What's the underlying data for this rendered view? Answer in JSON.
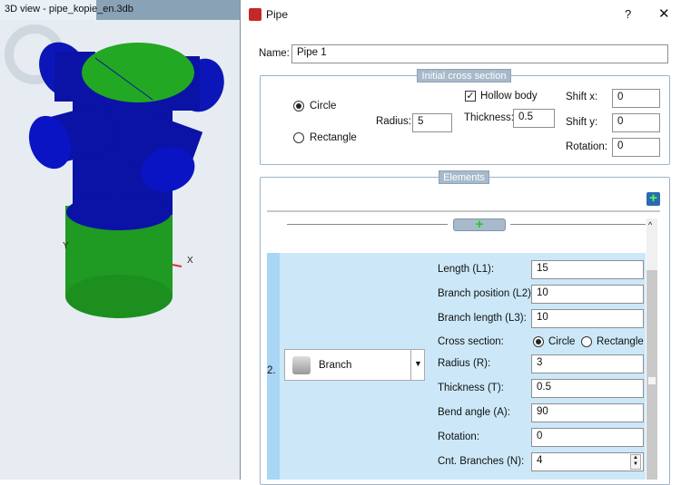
{
  "view": {
    "tab_title": "3D view - pipe_kopie_en.3db",
    "axis_x": "X",
    "axis_y": "Y"
  },
  "dialog": {
    "title": "Pipe",
    "help": "?",
    "close": "✕",
    "name_label": "Name:",
    "name_value": "Pipe 1",
    "initial": {
      "legend": "Initial cross section",
      "circle": "Circle",
      "rectangle": "Rectangle",
      "radius_label": "Radius:",
      "radius": "5",
      "hollow": "Hollow body",
      "thickness_label": "Thickness:",
      "thickness": "0.5",
      "shiftx_label": "Shift x:",
      "shiftx": "0",
      "shifty_label": "Shift y:",
      "shifty": "0",
      "rotation_label": "Rotation:",
      "rotation": "0"
    },
    "elements": {
      "legend": "Elements",
      "index": "2.",
      "type": "Branch",
      "fields": [
        {
          "label": "Length (L1):",
          "value": "15"
        },
        {
          "label": "Branch position (L2):",
          "value": "10"
        },
        {
          "label": "Branch length (L3):",
          "value": "10"
        }
      ],
      "cross_label": "Cross section:",
      "cross_circle": "Circle",
      "cross_rect": "Rectangle",
      "fields2": [
        {
          "label": "Radius (R):",
          "value": "3"
        },
        {
          "label": "Thickness (T):",
          "value": "0.5"
        },
        {
          "label": "Bend angle (A):",
          "value": "90"
        },
        {
          "label": "Rotation:",
          "value": "0"
        },
        {
          "label": "Cnt. Branches (N):",
          "value": "4"
        }
      ]
    }
  },
  "colors": {
    "accent": "#cce8f8",
    "pipe_blue": "#0a14a8",
    "pipe_green": "#1e9c1e"
  }
}
